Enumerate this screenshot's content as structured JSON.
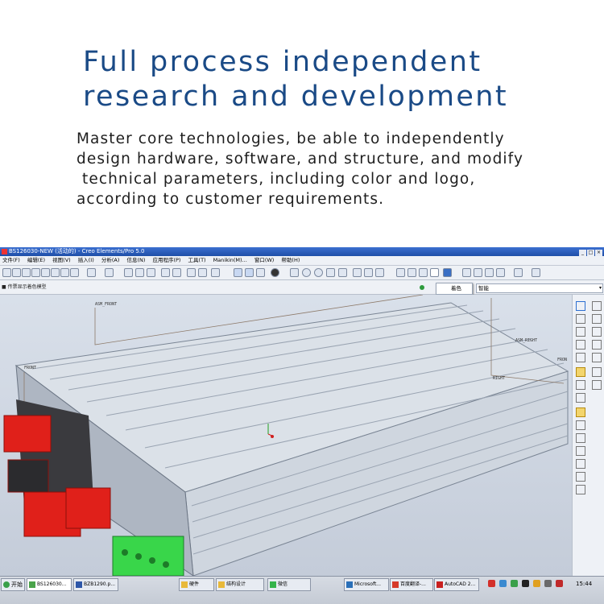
{
  "headline": {
    "line1": "Full process independent",
    "line2": "research and development"
  },
  "description": {
    "line1": "Master core technologies, be able to independently",
    "line2": "design hardware, software, and structure, and modify",
    "line3": " technical parameters, including color and logo,",
    "line4": "according to customer requirements."
  },
  "window": {
    "title": "BS126030-NEW (活动的) - Creo Elements/Pro 5.0",
    "controls": [
      "_",
      "□",
      "×"
    ]
  },
  "menu": {
    "items": [
      "文件(F)",
      "编辑(E)",
      "视图(V)",
      "插入(I)",
      "分析(A)",
      "信息(N)",
      "应用程序(P)",
      "工具(T)",
      "Manikin(M)...",
      "窗口(W)",
      "帮助(H)"
    ]
  },
  "toolbar2": {
    "model_tree_label": "■ 传票显示着色模型",
    "filter_label": "着色",
    "smart_select_value": "智能"
  },
  "viewport": {
    "datum_labels": [
      "ASM_FRONT",
      "FRONT",
      "RIGHT",
      "ASM_RIGHT",
      "FRON"
    ]
  },
  "taskbar": {
    "start_label": "开始",
    "items": [
      "BS126030...",
      "BZB1290.p...",
      "硬件",
      "结构设计",
      "微信",
      "Microsoft...",
      "百度翻译-...",
      "AutoCAD 2..."
    ],
    "clock": "15:44"
  },
  "colors": {
    "headline": "#1a4a86",
    "titlebar": "#2a5cc0",
    "connector_red": "#e0201a",
    "terminal_green": "#39d64a",
    "housing": "#d8dee6"
  }
}
